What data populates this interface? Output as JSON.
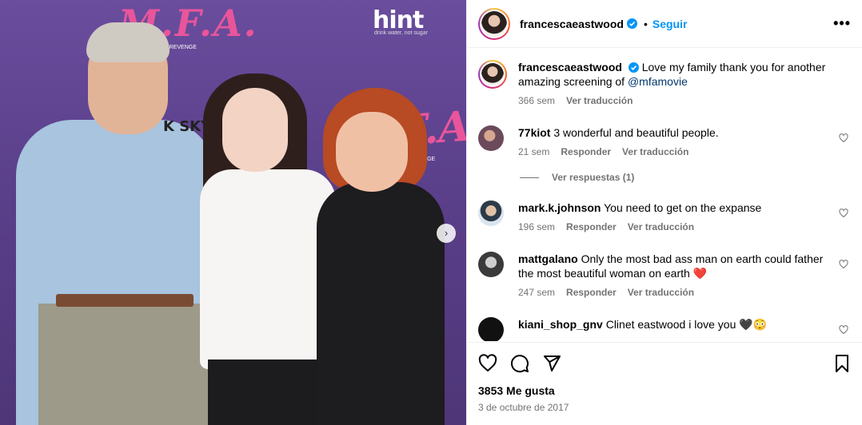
{
  "photo": {
    "backdrop_title": "M.F.A.",
    "backdrop_title_2": "F.A.",
    "sponsor": "hint",
    "sponsor_tagline": "drink water, not sugar",
    "backdrop_word": "K SKY",
    "revenge_text": "OF REVENGE",
    "revenge_text_2": "REVENGE",
    "next_arrow": "›"
  },
  "header": {
    "username": "francescaeastwood",
    "dot": "•",
    "follow_label": "Seguir",
    "more": "•••"
  },
  "caption": {
    "username": "francescaeastwood",
    "text": "Love my family thank you for another amazing screening of",
    "mention": "@mfamovie",
    "age": "366 sem",
    "translate": "Ver traducción"
  },
  "comments": [
    {
      "username": "77kiot",
      "text": "3 wonderful and beautiful people.",
      "age": "21 sem",
      "reply": "Responder",
      "translate": "Ver traducción",
      "avatar_color": "#6b4a5c"
    },
    {
      "username": "mark.k.johnson",
      "text": "You need to get on the expanse",
      "age": "196 sem",
      "reply": "Responder",
      "translate": "Ver traducción",
      "avatar_color": "#5c7fa3"
    },
    {
      "username": "mattgalano",
      "text": "Only the most bad ass man on earth could father the most beautiful woman on earth",
      "emoji": "❤️",
      "age": "247 sem",
      "reply": "Responder",
      "translate": "Ver traducción",
      "avatar_color": "#3a3a3a"
    },
    {
      "username": "kiani_shop_gnv",
      "text": "Clinet eastwood i love you",
      "emoji": "🖤😳",
      "avatar_color": "#111111"
    }
  ],
  "replies_label": "Ver respuestas (1)",
  "actions": {
    "likes": "3853 Me gusta",
    "date": "3 de octubre de 2017"
  },
  "colors": {
    "accent": "#0095f6",
    "muted": "#737373",
    "link": "#00376b",
    "heart": "#ed1c24"
  }
}
